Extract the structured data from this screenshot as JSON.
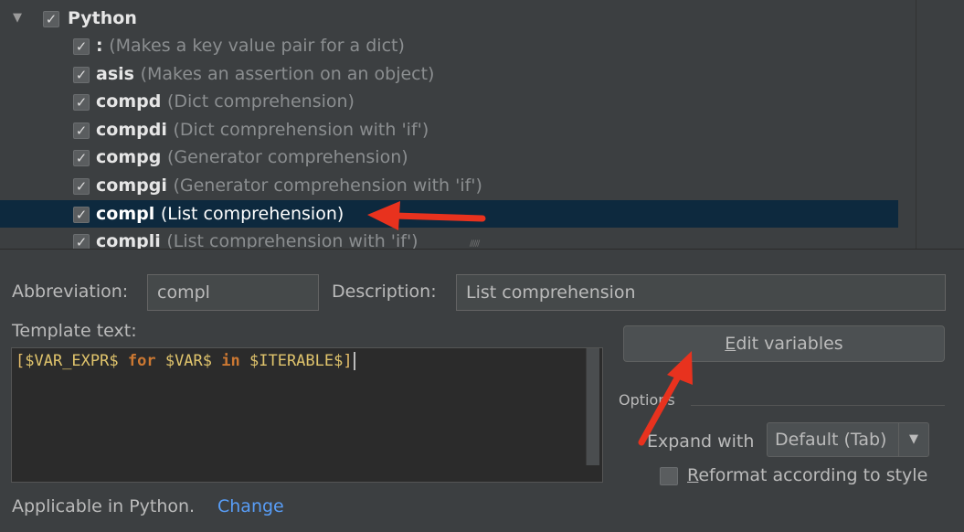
{
  "tree": {
    "group": {
      "label": "Python",
      "checked": true,
      "expanded": true
    },
    "items": [
      {
        "abbr": ":",
        "desc": "(Makes a key value pair for a dict)",
        "checked": true
      },
      {
        "abbr": "asis",
        "desc": "(Makes an assertion on an object)",
        "checked": true
      },
      {
        "abbr": "compd",
        "desc": "(Dict comprehension)",
        "checked": true
      },
      {
        "abbr": "compdi",
        "desc": "(Dict comprehension with 'if')",
        "checked": true
      },
      {
        "abbr": "compg",
        "desc": "(Generator comprehension)",
        "checked": true
      },
      {
        "abbr": "compgi",
        "desc": "(Generator comprehension with 'if')",
        "checked": true
      },
      {
        "abbr": "compl",
        "desc": "(List comprehension)",
        "checked": true,
        "selected": true
      },
      {
        "abbr": "compli",
        "desc": "(List comprehension with 'if')",
        "checked": true
      }
    ]
  },
  "form": {
    "abbreviation_label": "Abbreviation:",
    "abbreviation_value": "compl",
    "description_label": "Description:",
    "description_value": "List comprehension",
    "template_label": "Template text:",
    "template_tokens": {
      "open": "[",
      "var_expr": "$VAR_EXPR$",
      "kw_for": "for",
      "var": "$VAR$",
      "kw_in": "in",
      "iterable": "$ITERABLE$",
      "close": "]"
    },
    "edit_variables_mnemonic": "E",
    "edit_variables_rest": "dit variables",
    "options_label": "Options",
    "expand_with_label": "Expand with",
    "expand_with_value": "Default (Tab)",
    "reformat_mnemonic": "R",
    "reformat_rest": "eformat according to style",
    "reformat_checked": false,
    "applicable_text": "Applicable in Python.",
    "change_link": "Change"
  },
  "colors": {
    "background": "#3c3f41",
    "selection": "#0d293e",
    "link": "#589df6",
    "arrow": "#e8321e",
    "keyword": "#cc7832",
    "template_variable": "#e0c46c"
  },
  "icons": {
    "expander": "triangle-down-icon",
    "checkbox": "checkmark-icon",
    "dropdown": "chevron-down-icon"
  }
}
